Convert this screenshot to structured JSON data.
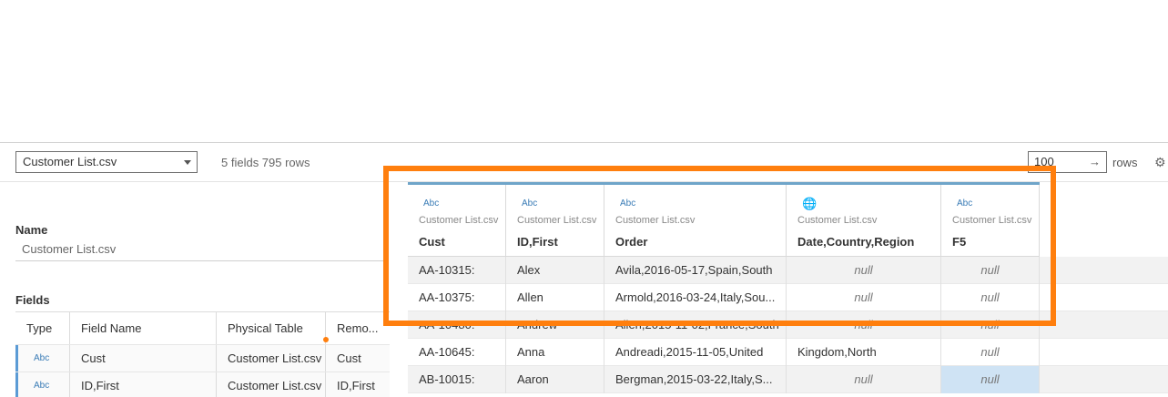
{
  "toolbar": {
    "source_select": "Customer List.csv",
    "summary": "5 fields 795 rows",
    "rows_value": "100",
    "rows_label": "rows",
    "rows_arrow": "→",
    "gear": "⚙"
  },
  "left_panel": {
    "name_label": "Name",
    "name_value": "Customer List.csv",
    "fields_label": "Fields",
    "collapse_glyph": "‹",
    "columns": [
      "Type",
      "Field Name",
      "Physical Table",
      "Remo..."
    ],
    "rows": [
      {
        "type": "Abc",
        "field": "Cust",
        "table": "Customer List.csv",
        "remote": "Cust"
      },
      {
        "type": "Abc",
        "field": "ID,First",
        "table": "Customer List.csv",
        "remote": "ID,First"
      }
    ]
  },
  "grid": {
    "columns": [
      {
        "type": "Abc",
        "icon": "text-type-icon",
        "source": "Customer List.csv",
        "name": "Cust"
      },
      {
        "type": "Abc",
        "icon": "text-type-icon",
        "source": "Customer List.csv",
        "name": "ID,First"
      },
      {
        "type": "Abc",
        "icon": "text-type-icon",
        "source": "Customer List.csv",
        "name": "Order"
      },
      {
        "type": "🌐",
        "icon": "globe-icon",
        "source": "Customer List.csv",
        "name": "Date,Country,Region"
      },
      {
        "type": "Abc",
        "icon": "text-type-icon",
        "source": "Customer List.csv",
        "name": "F5"
      }
    ],
    "rows": [
      [
        "AA-10315:",
        "Alex",
        "Avila,2016-05-17,Spain,South",
        "null",
        "null"
      ],
      [
        "AA-10375:",
        "Allen",
        "Armold,2016-03-24,Italy,Sou...",
        "null",
        "null"
      ],
      [
        "AA-10480:",
        "Andrew",
        "Allen,2015-11-02,France,South",
        "null",
        "null"
      ],
      [
        "AA-10645:",
        "Anna",
        "Andreadi,2015-11-05,United",
        "Kingdom,North",
        "null"
      ],
      [
        "AB-10015:",
        "Aaron",
        "Bergman,2015-03-22,Italy,S...",
        "null",
        "null"
      ]
    ]
  },
  "colors": {
    "highlight": "#ff7f0e",
    "header_accent": "#6fa5c9",
    "type_icon": "#3a7cb6",
    "selected_cell": "#cfe3f4"
  }
}
